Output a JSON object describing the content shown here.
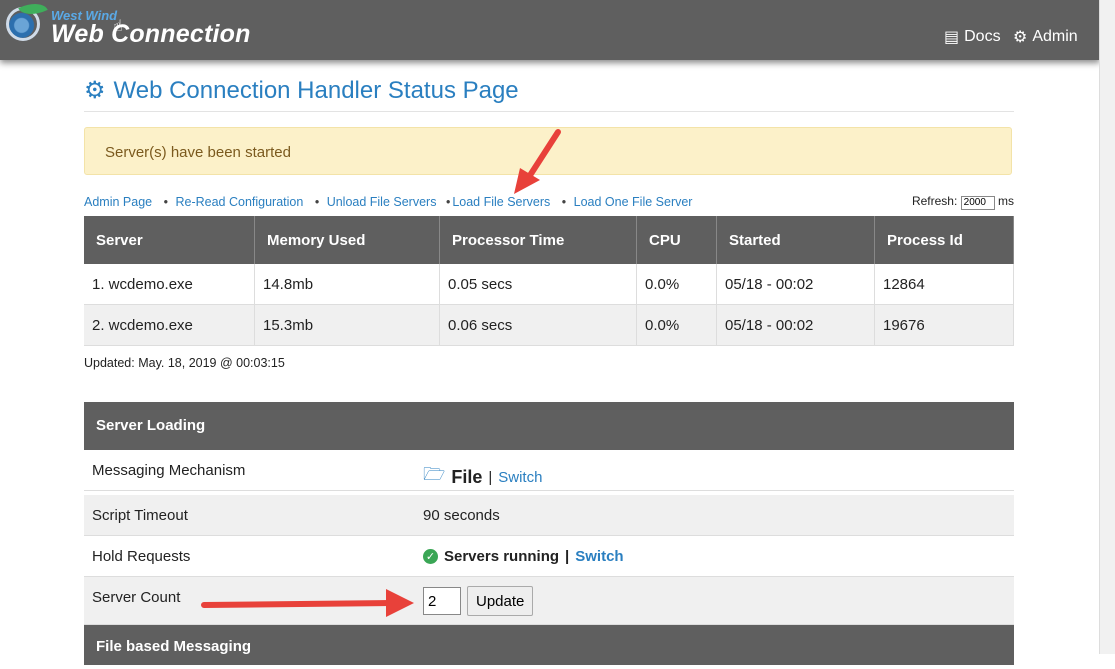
{
  "brand": {
    "small": "West Wind",
    "big": "Web Connection"
  },
  "nav": {
    "docs": "Docs",
    "admin": "Admin"
  },
  "page_title": "Web Connection Handler Status Page",
  "alert": "Server(s) have been started",
  "links": [
    "Admin Page",
    "Re-Read Configuration",
    "Unload File Servers",
    "Load File Servers",
    "Load One File Server"
  ],
  "refresh": {
    "label": "Refresh:",
    "value": "2000",
    "unit": "ms"
  },
  "table": {
    "headers": [
      "Server",
      "Memory Used",
      "Processor Time",
      "CPU",
      "Started",
      "Process Id"
    ],
    "rows": [
      [
        "1. wcdemo.exe",
        "14.8mb",
        "0.05 secs",
        "0.0%",
        "05/18 - 00:02",
        "12864"
      ],
      [
        "2. wcdemo.exe",
        "15.3mb",
        "0.06 secs",
        "0.0%",
        "05/18 - 00:02",
        "19676"
      ]
    ]
  },
  "updated": "Updated: May. 18, 2019 @ 00:03:15",
  "server_loading": {
    "title": "Server Loading",
    "messaging_label": "Messaging Mechanism",
    "messaging_value": "File",
    "messaging_switch": "Switch",
    "timeout_label": "Script Timeout",
    "timeout_value": "90 seconds",
    "hold_label": "Hold Requests",
    "hold_value": "Servers running",
    "hold_switch": "Switch",
    "count_label": "Server Count",
    "count_value": "2",
    "update_button": "Update"
  },
  "file_messaging_title": "File based Messaging",
  "colors": {
    "header_bg": "#5f5f5f",
    "link": "#2a7fc0",
    "alert_bg": "#fcf1c9",
    "arrow": "#e8413a"
  }
}
